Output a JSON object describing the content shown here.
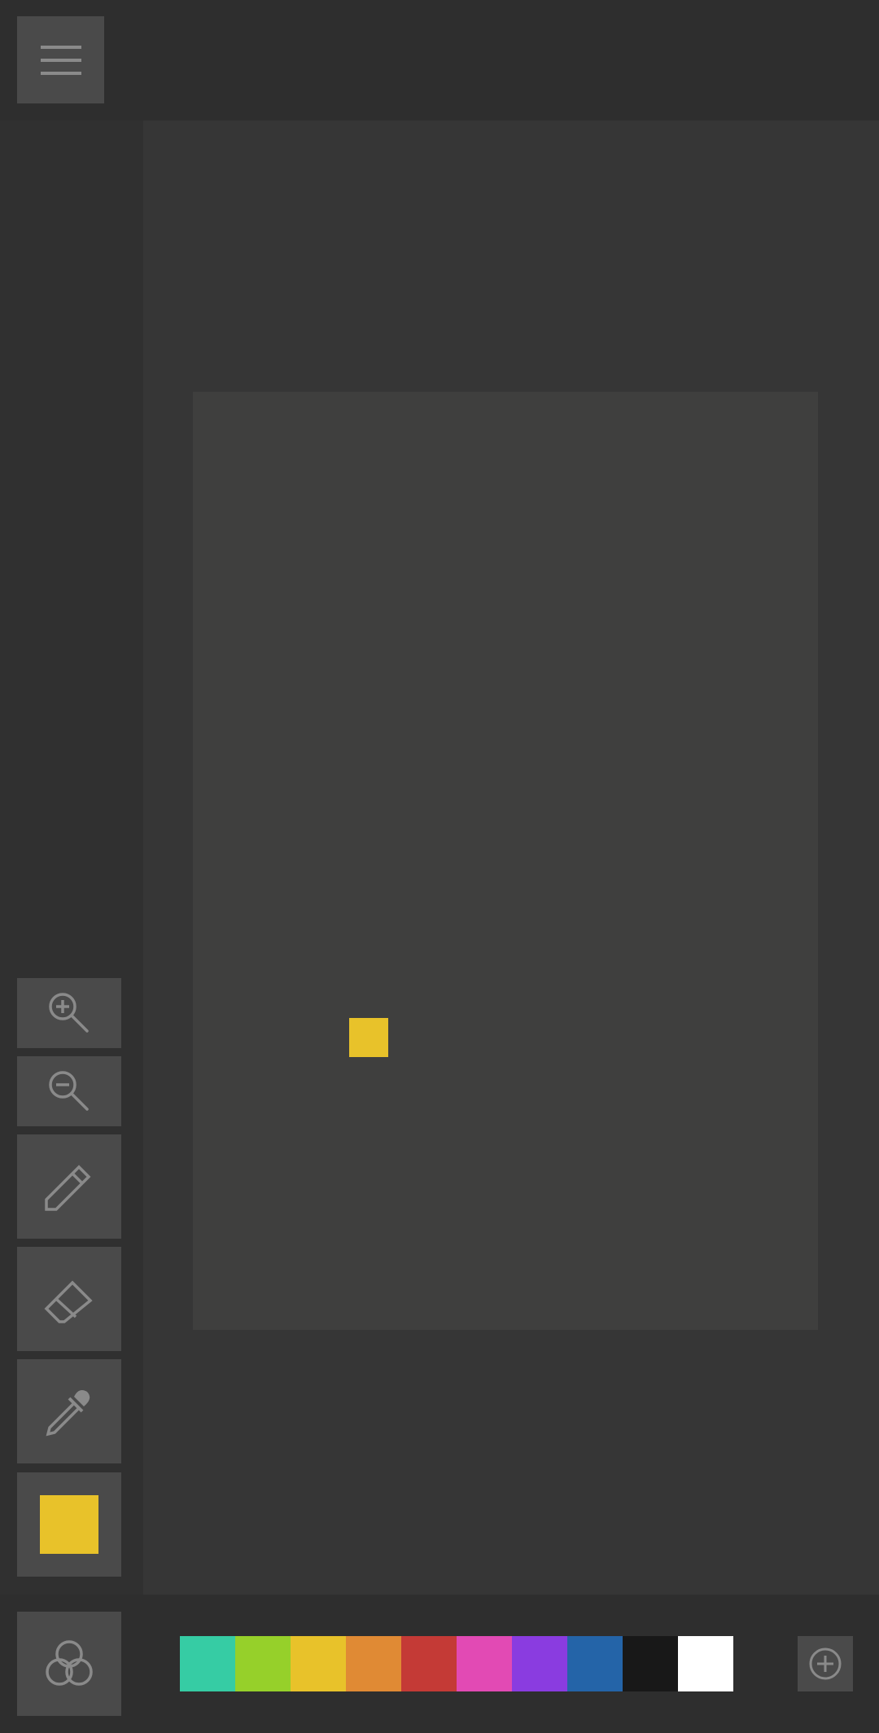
{
  "menu": {
    "icon": "hamburger-menu-icon"
  },
  "toolbar": {
    "zoom_in_icon": "zoom-in-icon",
    "zoom_out_icon": "zoom-out-icon",
    "pencil_icon": "pencil-icon",
    "eraser_icon": "eraser-icon",
    "eyedropper_icon": "eyedropper-icon",
    "current_color": "#e8c22a"
  },
  "canvas": {
    "background": "#3f3f3e",
    "pixels": [
      {
        "color": "#e8c22a"
      }
    ]
  },
  "bottom_bar": {
    "color_mixer_icon": "color-mixer-icon",
    "add_color_icon": "add-color-icon",
    "palette": [
      "#36cca4",
      "#96d02a",
      "#e8c22a",
      "#e08a34",
      "#c43a36",
      "#e24ab4",
      "#8a3ce0",
      "#2464a8",
      "#181818",
      "#ffffff"
    ]
  }
}
